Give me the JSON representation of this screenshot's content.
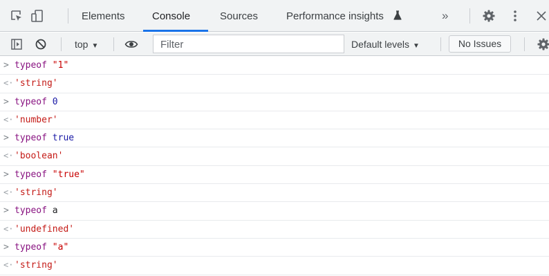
{
  "tabs": {
    "items": [
      {
        "label": "Elements"
      },
      {
        "label": "Console",
        "active": true
      },
      {
        "label": "Sources"
      },
      {
        "label": "Performance insights"
      }
    ],
    "more_label": "»",
    "accent": "#1a73e8"
  },
  "toolbar": {
    "context_label": "top",
    "filter_placeholder": "Filter",
    "levels_label": "Default levels",
    "issues_label": "No Issues"
  },
  "console": {
    "entries": [
      {
        "input_keyword": "typeof",
        "input_arg": "\"1\"",
        "output": "'string'"
      },
      {
        "input_keyword": "typeof",
        "input_arg": "0",
        "output": "'number'"
      },
      {
        "input_keyword": "typeof",
        "input_arg": "true",
        "output": "'boolean'"
      },
      {
        "input_keyword": "typeof",
        "input_arg": "\"true\"",
        "output": "'string'"
      },
      {
        "input_keyword": "typeof",
        "input_arg": "a",
        "output": "'undefined'"
      },
      {
        "input_keyword": "typeof",
        "input_arg": "\"a\"",
        "output": "'string'"
      }
    ],
    "input_prompt": ">",
    "output_prompt": "<·"
  },
  "icons": [
    "inspect-element-icon",
    "device-toolbar-icon",
    "experiment-flask-icon",
    "settings-gear-icon",
    "kebab-menu-icon",
    "close-icon",
    "sidebar-toggle-icon",
    "clear-console-icon",
    "live-expression-eye-icon",
    "console-settings-gear-icon"
  ],
  "colors": {
    "keyword": "#a626a4",
    "string_result": "#c41a16",
    "string_input": "#c80000",
    "number": "#1a1aa6",
    "toolbar_bg": "#f1f3f4"
  }
}
